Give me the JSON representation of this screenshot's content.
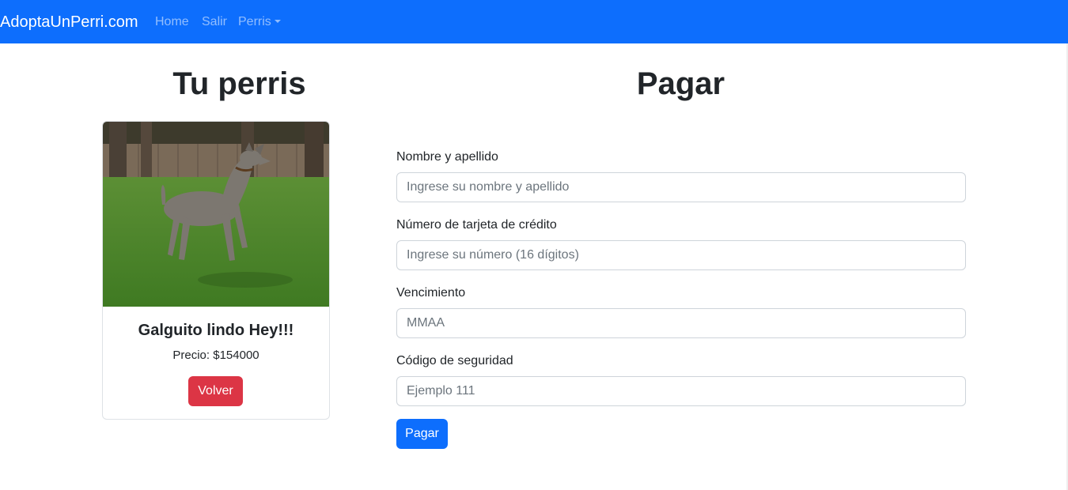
{
  "navbar": {
    "brand": "AdoptaUnPerri.com",
    "links": [
      "Home",
      "Salir"
    ],
    "dropdown_label": "Perris",
    "color": "#0d6efd"
  },
  "left": {
    "heading": "Tu perris",
    "card": {
      "title": "Galguito lindo Hey!!!",
      "price": "Precio: $154000",
      "button": "Volver",
      "button_color": "#dc3545"
    }
  },
  "right": {
    "heading": "Pagar",
    "fields": [
      {
        "label": "Nombre y apellido",
        "placeholder": "Ingrese su nombre y apellido",
        "value": ""
      },
      {
        "label": "Número de tarjeta de crédito",
        "placeholder": "Ingrese su número (16 dígitos)",
        "value": ""
      },
      {
        "label": "Vencimiento",
        "placeholder": "MMAA",
        "value": ""
      },
      {
        "label": "Código de seguridad",
        "placeholder": "Ejemplo 111",
        "value": ""
      }
    ],
    "submit": "Pagar",
    "submit_color": "#0d6efd"
  }
}
